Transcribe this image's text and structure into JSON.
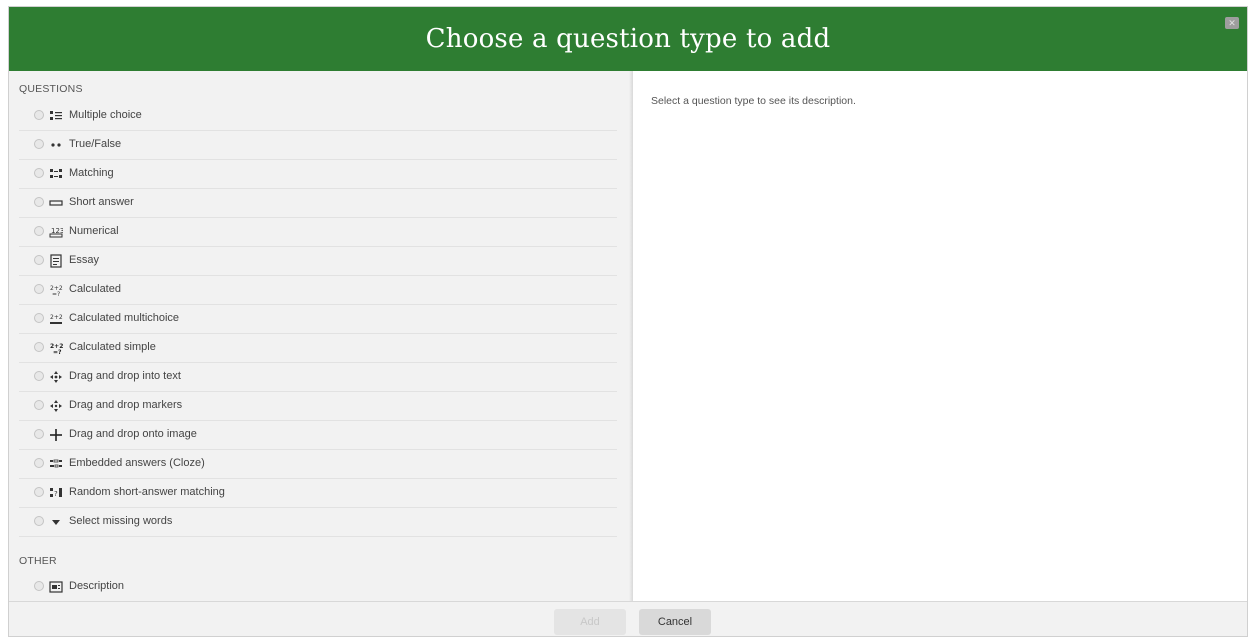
{
  "dialog": {
    "title": "Choose a question type to add",
    "close_label": "✕"
  },
  "sections": {
    "questions_label": "QUESTIONS",
    "other_label": "OTHER"
  },
  "questions": [
    {
      "label": "Multiple choice",
      "icon": "multichoice-icon"
    },
    {
      "label": "True/False",
      "icon": "truefalse-icon"
    },
    {
      "label": "Matching",
      "icon": "matching-icon"
    },
    {
      "label": "Short answer",
      "icon": "shortanswer-icon"
    },
    {
      "label": "Numerical",
      "icon": "numerical-icon"
    },
    {
      "label": "Essay",
      "icon": "essay-icon"
    },
    {
      "label": "Calculated",
      "icon": "calculated-icon"
    },
    {
      "label": "Calculated multichoice",
      "icon": "calculated-multichoice-icon"
    },
    {
      "label": "Calculated simple",
      "icon": "calculated-simple-icon"
    },
    {
      "label": "Drag and drop into text",
      "icon": "drag-drop-text-icon"
    },
    {
      "label": "Drag and drop markers",
      "icon": "drag-drop-markers-icon"
    },
    {
      "label": "Drag and drop onto image",
      "icon": "drag-drop-image-icon"
    },
    {
      "label": "Embedded answers (Cloze)",
      "icon": "cloze-icon"
    },
    {
      "label": "Random short-answer matching",
      "icon": "random-matching-icon"
    },
    {
      "label": "Select missing words",
      "icon": "select-missing-words-icon"
    }
  ],
  "other": [
    {
      "label": "Description",
      "icon": "description-icon"
    }
  ],
  "description_text": "Select a question type to see its description.",
  "footer": {
    "add_label": "Add",
    "cancel_label": "Cancel"
  },
  "colors": {
    "header_bg": "#2e7d32",
    "options_bg": "#f2f2f2"
  }
}
